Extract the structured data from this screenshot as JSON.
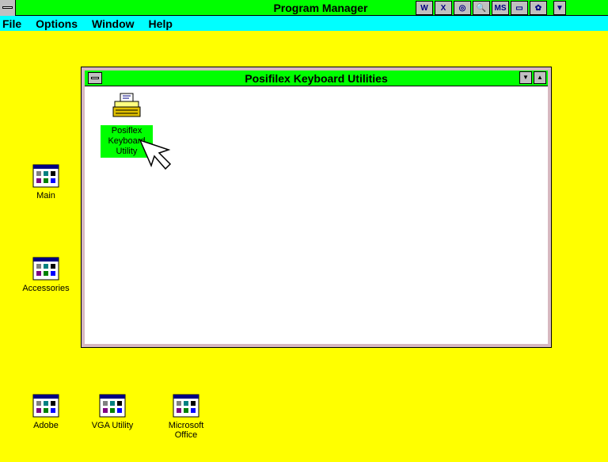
{
  "program_manager": {
    "title": "Program Manager",
    "tray_icons": [
      "W-icon",
      "X-icon",
      "compass-icon",
      "search-icon",
      "MS-icon",
      "binoculars-icon",
      "gear-icon",
      "dropdown-arrow-icon"
    ]
  },
  "menu": {
    "file": "File",
    "options": "Options",
    "window": "Window",
    "help": "Help"
  },
  "child_window": {
    "title": "Posifilex Keyboard Utilities",
    "program": {
      "line1": "Posiflex",
      "line2": "Keyboard",
      "line3": "Utility"
    }
  },
  "desktop_groups": {
    "main": "Main",
    "accessories": "Accessories",
    "adobe": "Adobe",
    "vga": "VGA Utility",
    "office_line1": "Microsoft",
    "office_line2": "Office"
  },
  "colors": {
    "titlebar": "#00ff00",
    "menubar": "#00ffff",
    "desktop": "#ffff00"
  }
}
